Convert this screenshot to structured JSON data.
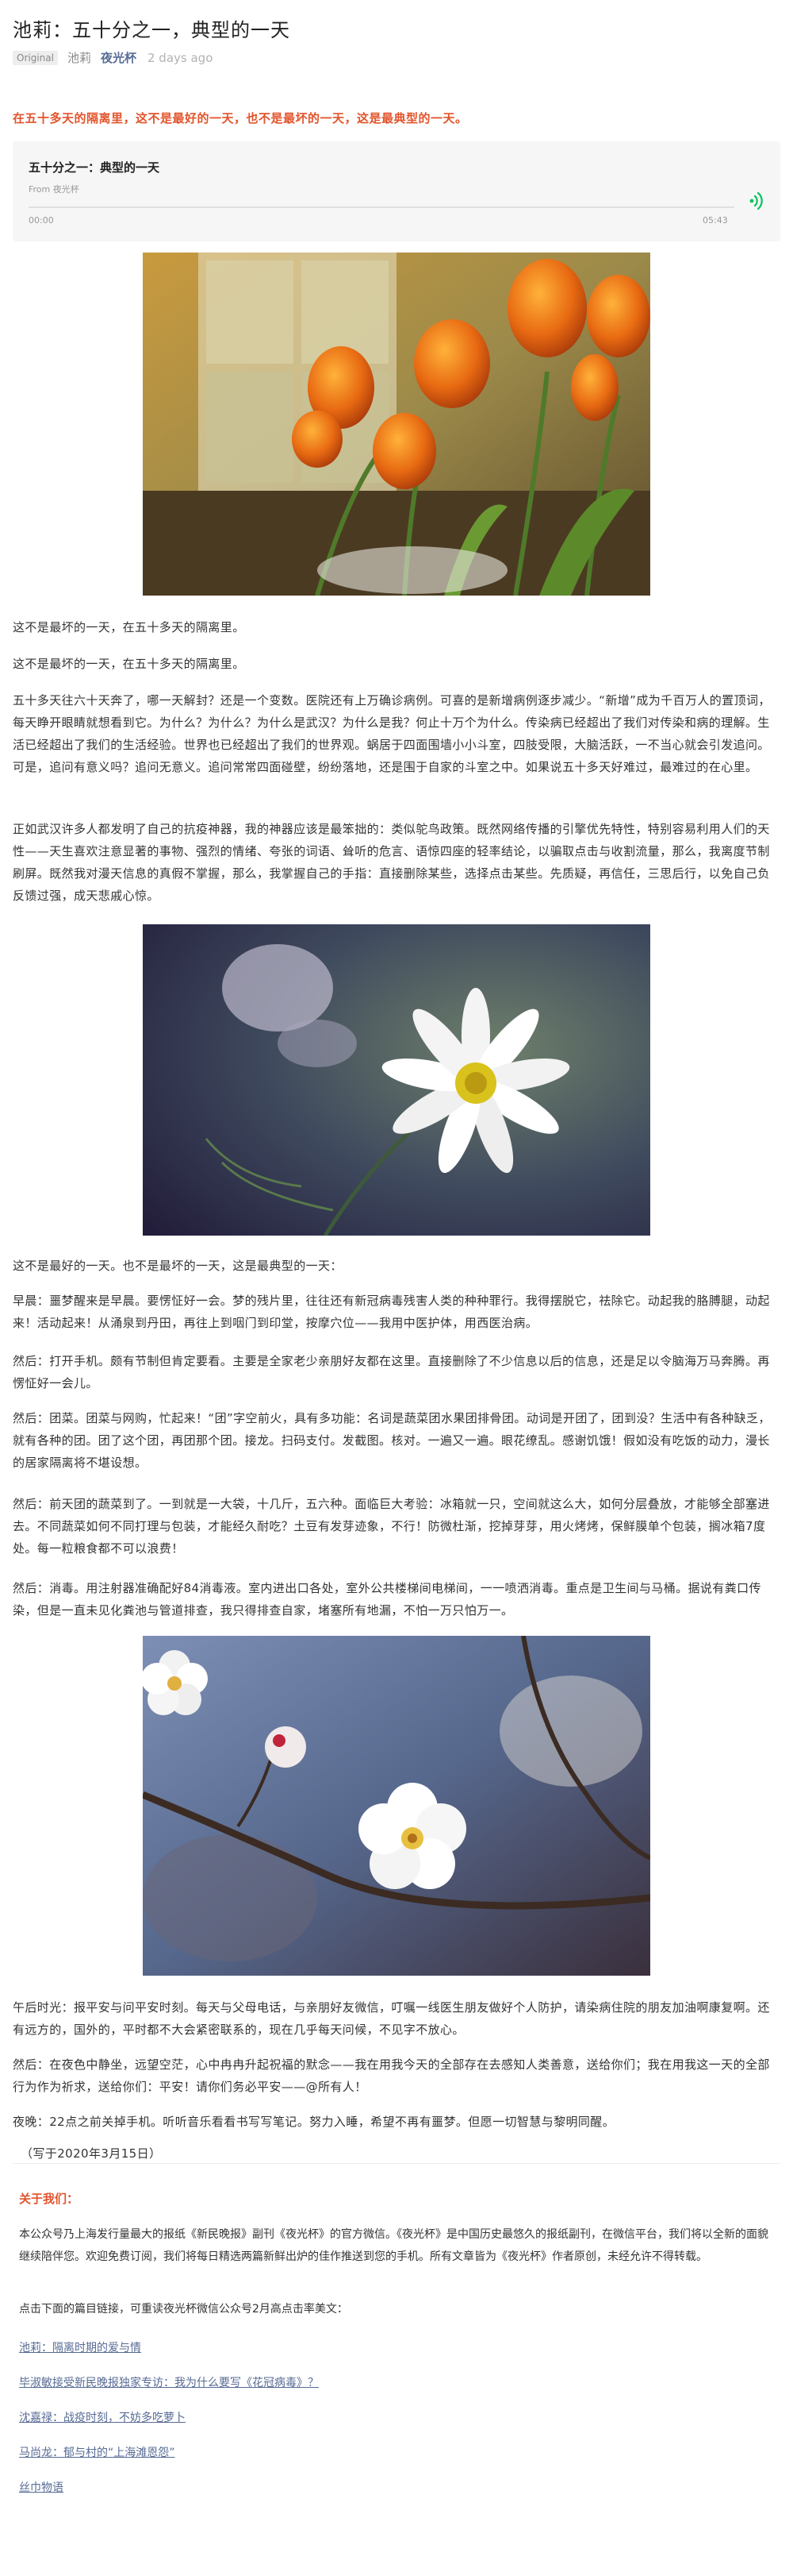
{
  "article": {
    "title": "池莉：五十分之一，典型的一天",
    "badge": "Original",
    "author": "池莉",
    "account": "夜光杯",
    "time": "2 days ago",
    "intro": "在五十多天的隔离里，这不是最好的一天，也不是最坏的一天，这是最典型的一天。"
  },
  "audio": {
    "title": "五十分之一：典型的一天",
    "from": "From 夜光杯",
    "start": "00:00",
    "end": "05:43",
    "progress": 0
  },
  "paragraphs": [
    "这不是最坏的一天，在五十多天的隔离里。",
    "这不是最坏的一天，在五十多天的隔离里。",
    "五十多天往六十天奔了，哪一天解封？还是一个变数。医院还有上万确诊病例。可喜的是新增病例逐步减少。“新增”成为千百万人的置顶词，每天睁开眼睛就想看到它。为什么？为什么？为什么是武汉？为什么是我？何止十万个为什么。传染病已经超出了我们对传染和病的理解。生活已经超出了我们的生活经验。世界也已经超出了我们的世界观。蜗居于四面围墙小小斗室，四肢受限，大脑活跃，一不当心就会引发追问。可是，追问有意义吗？追问无意义。追问常常四面碰壁，纷纷落地，还是围于自家的斗室之中。如果说五十多天好难过，最难过的在心里。",
    "正如武汉许多人都发明了自己的抗疫神器，我的神器应该是最笨拙的：类似鸵鸟政策。既然网络传播的引擎优先特性，特别容易利用人们的天性——天生喜欢注意显著的事物、强烈的情绪、夸张的词语、耸听的危言、语惊四座的轻率结论，以骗取点击与收割流量，那么，我离度节制刷屏。既然我对漫天信息的真假不掌握，那么，我掌握自己的手指：直接删除某些，选择点击某些。先质疑，再信任，三思后行，以免自己负反馈过强，成天悲戚心惊。",
    "这不是最好的一天。也不是最坏的一天，这是最典型的一天：",
    "早晨：噩梦醒来是早晨。要愣怔好一会。梦的残片里，往往还有新冠病毒残害人类的种种罪行。我得摆脱它，祛除它。动起我的胳膊腿，动起来！活动起来！从涌泉到丹田，再往上到咽门到印堂，按摩穴位——我用中医护体，用西医治病。",
    "然后：打开手机。颇有节制但肯定要看。主要是全家老少亲朋好友都在这里。直接删除了不少信息以后的信息，还是足以令脑海万马奔腾。再愣怔好一会儿。",
    "然后：团菜。团菜与网购，忙起来！“团”字空前火，具有多功能：名词是蔬菜团水果团排骨团。动词是开团了，团到没？生活中有各种缺乏，就有各种的团。团了这个团，再团那个团。接龙。扫码支付。发截图。核对。一遍又一遍。眼花缭乱。感谢饥饿！假如没有吃饭的动力，漫长的居家隔离将不堪设想。",
    "然后：前天团的蔬菜到了。一到就是一大袋，十几斤，五六种。面临巨大考验：冰箱就一只，空间就这么大，如何分层叠放，才能够全部塞进去。不同蔬菜如何不同打理与包装，才能经久耐吃？土豆有发芽迹象，不行！防微杜渐，挖掉芽芽，用火烤烤，保鲜膜单个包装，搁冰箱7度处。每一粒粮食都不可以浪费！",
    "然后：消毒。用注射器准确配好84消毒液。室内进出口各处，室外公共楼梯间电梯间，一一喷洒消毒。重点是卫生间与马桶。据说有粪口传染，但是一直未见化粪池与管道排查，我只得排查自家，堵塞所有地漏，不怕一万只怕万一。",
    "午后时光：报平安与问平安时刻。每天与父母电话，与亲朋好友微信，叮嘱一线医生朋友做好个人防护，请染病住院的朋友加油啊康复啊。还有远方的，国外的，平时都不大会紧密联系的，现在几乎每天问候，不见字不放心。",
    "然后：在夜色中静坐，远望空茫，心中冉冉升起祝福的默念——我在用我今天的全部存在去感知人类善意，送给你们；我在用我这一天的全部行为作为祈求，送给你们：平安！请你们务必平安——@所有人！",
    "夜晚：22点之前关掉手机。听听音乐看看书写写笔记。努力入睡，希望不再有噩梦。但愿一切智慧与黎明同醒。",
    "（写于2020年3月15日）"
  ],
  "footer": {
    "head": "关于我们：",
    "about": "本公众号乃上海发行量最大的报纸《新民晚报》副刊《夜光杯》的官方微信。《夜光杯》是中国历史最悠久的报纸副刊，在微信平台，我们将以全新的面貌继续陪伴您。欢迎免费订阅，我们将每日精选两篇新鲜出炉的佳作推送到您的手机。所有文章皆为《夜光杯》作者原创，未经允许不得转载。",
    "prompt": "点击下面的篇目链接，可重读夜光杯微信公众号2月高点击率美文：",
    "links": [
      "池莉：隔离时期的爱与情",
      "毕淑敏接受新民晚报独家专访：我为什么要写《花冠病毒》？",
      "沈嘉禄：战疫时刻，不妨多吃萝卜",
      "马尚龙：郁与村的“上海滩恩怨”",
      "丝巾物语"
    ]
  },
  "colors": {
    "accent": "#e2542b",
    "link": "#576b95",
    "audio_play": "#07c160"
  },
  "icons": {
    "audio_play": "audio-play-icon"
  }
}
